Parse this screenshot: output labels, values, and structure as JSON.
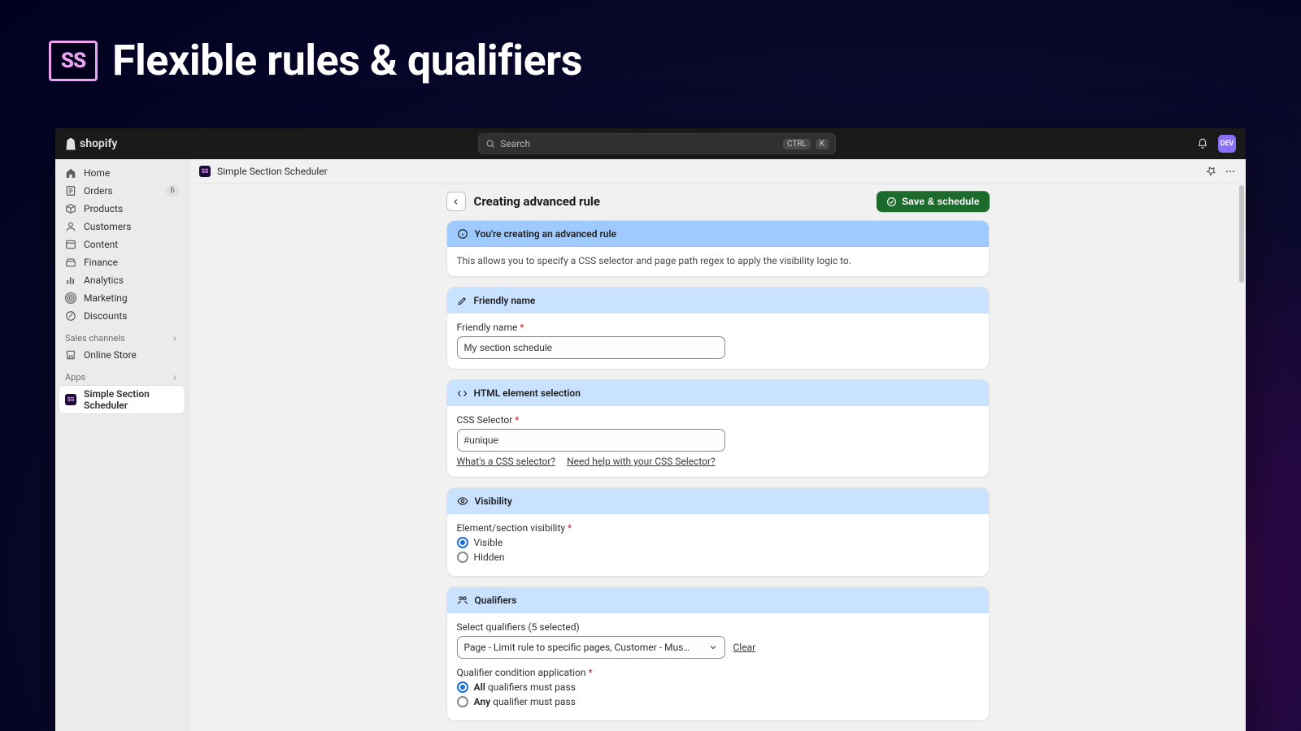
{
  "hero": {
    "logo_text": "SS",
    "title": "Flexible rules & qualifiers"
  },
  "topbar": {
    "brand": "shopify",
    "search_placeholder": "Search",
    "shortcut_ctrl": "CTRL",
    "shortcut_k": "K",
    "avatar_text": "DEV"
  },
  "sidebar": {
    "items": [
      {
        "label": "Home",
        "icon": "home"
      },
      {
        "label": "Orders",
        "icon": "orders",
        "badge": "6"
      },
      {
        "label": "Products",
        "icon": "products"
      },
      {
        "label": "Customers",
        "icon": "customers"
      },
      {
        "label": "Content",
        "icon": "content"
      },
      {
        "label": "Finance",
        "icon": "finance"
      },
      {
        "label": "Analytics",
        "icon": "analytics"
      },
      {
        "label": "Marketing",
        "icon": "marketing"
      },
      {
        "label": "Discounts",
        "icon": "discounts"
      }
    ],
    "sales_channels_label": "Sales channels",
    "online_store_label": "Online Store",
    "apps_label": "Apps",
    "app_item_label": "Simple Section Scheduler"
  },
  "content_header": {
    "app_name": "Simple Section Scheduler"
  },
  "page": {
    "title": "Creating advanced rule",
    "save_label": "Save & schedule",
    "banner": {
      "heading": "You're creating an advanced rule",
      "body": "This allows you to specify a CSS selector and page path regex to apply the visibility logic to."
    },
    "friendly": {
      "section_title": "Friendly name",
      "label": "Friendly name",
      "value": "My section schedule"
    },
    "html": {
      "section_title": "HTML element selection",
      "label": "CSS Selector",
      "value": "#unique",
      "help1": "What's a CSS selector?",
      "help2": "Need help with your CSS Selector?"
    },
    "visibility": {
      "section_title": "Visibility",
      "label": "Element/section visibility",
      "opt_visible": "Visible",
      "opt_hidden": "Hidden"
    },
    "qualifiers": {
      "section_title": "Qualifiers",
      "select_label": "Select qualifiers (5 selected)",
      "select_value": "Page - Limit rule to specific pages, Customer - Must be log...",
      "clear_label": "Clear",
      "condition_label": "Qualifier condition application",
      "opt_all_bold": "All",
      "opt_all_rest": " qualifiers must pass",
      "opt_any_bold": "Any",
      "opt_any_rest": " qualifier must pass"
    }
  }
}
